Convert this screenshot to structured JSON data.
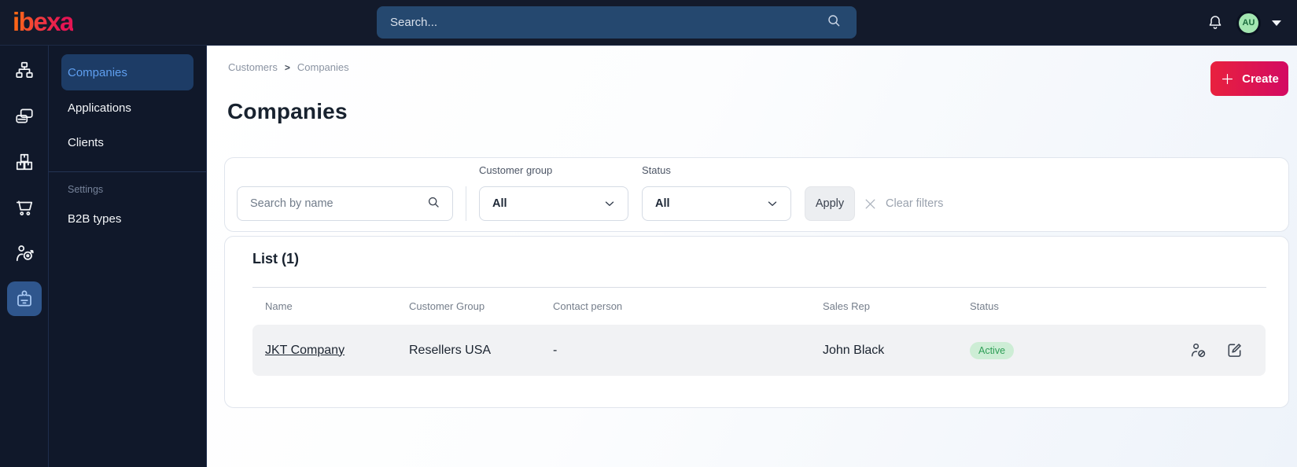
{
  "topbar": {
    "logo_text": "ibexa",
    "search_placeholder": "Search...",
    "avatar_initials": "AU"
  },
  "sidebar": {
    "rail_icons": [
      "content-structure-icon",
      "pages-icon",
      "products-icon",
      "cart-icon",
      "personalization-icon",
      "b2b-badge-icon"
    ],
    "rail_active_index": 5,
    "menu": {
      "items": [
        {
          "label": "Companies",
          "active": true
        },
        {
          "label": "Applications",
          "active": false
        },
        {
          "label": "Clients",
          "active": false
        }
      ],
      "section": {
        "label": "Settings",
        "items": [
          {
            "label": "B2B types"
          }
        ]
      }
    }
  },
  "page": {
    "breadcrumb": {
      "items": [
        "Customers",
        "Companies"
      ],
      "separator": ">"
    },
    "title": "Companies",
    "create_button": "Create"
  },
  "filters": {
    "search_placeholder": "Search by name",
    "customer_group": {
      "label": "Customer group",
      "value": "All"
    },
    "status": {
      "label": "Status",
      "value": "All"
    },
    "apply_label": "Apply",
    "clear_label": "Clear filters"
  },
  "list": {
    "heading": "List (1)",
    "columns": [
      "Name",
      "Customer Group",
      "Contact person",
      "Sales Rep",
      "Status"
    ],
    "rows": [
      {
        "name": "JKT Company",
        "customer_group": "Resellers USA",
        "contact_person": "-",
        "sales_rep": "John Black",
        "status": "Active"
      }
    ]
  },
  "colors": {
    "topbar_bg": "#131a2b",
    "search_bg": "#25486f",
    "accent_gradient_start": "#e8213e",
    "accent_gradient_end": "#d30a62",
    "active_nav_bg": "#1d3c66",
    "active_nav_text": "#5f9ff0",
    "rail_active_bg": "#2f568d",
    "badge_active_bg": "#cdedd5",
    "badge_active_text": "#2e9e57"
  }
}
